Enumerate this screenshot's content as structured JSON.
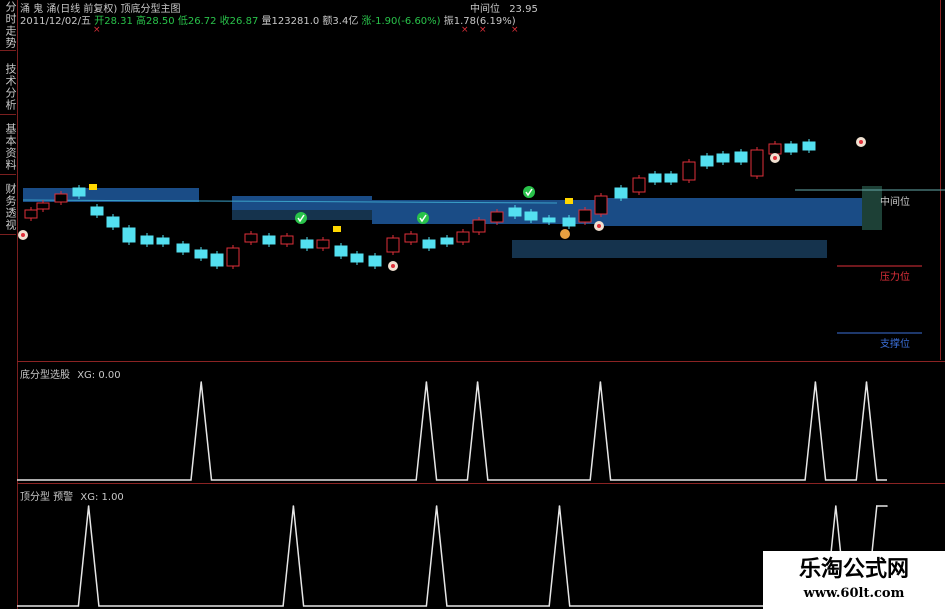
{
  "sidebar": {
    "tabs": [
      {
        "label": "分时走势"
      },
      {
        "label": "技术分析"
      },
      {
        "label": "基本资料"
      },
      {
        "label": "财务透视"
      }
    ]
  },
  "header": {
    "title_line": "涌 鬼 涌(日线 前复权) 顶底分型主图",
    "mid_label": "中间位",
    "mid_value": "23.95",
    "date": "2011/12/02/五",
    "open": "开28.31",
    "high": "高28.50",
    "low": "低26.72",
    "close": "收26.87",
    "volume": "量123281.0",
    "amount": "额3.4亿",
    "change": "涨-1.90(-6.60%)",
    "amplitude": "振1.78(6.19%)"
  },
  "levels": {
    "mid": "中间位",
    "pressure": "压力位",
    "support": "支撑位"
  },
  "panel1": {
    "label": "底分型选股",
    "value": "XG: 0.00"
  },
  "panel2": {
    "label": "顶分型 预警",
    "value": "XG: 1.00"
  },
  "watermark": {
    "title": "乐淘公式网",
    "url": "www.60lt.com"
  },
  "colors": {
    "up": "#e0303a",
    "down": "#54e0f0",
    "zone": "#1a4c86",
    "zone_dark": "#15334d",
    "grid_red": "#8b2323",
    "green": "#29c24a",
    "yellow": "#ffd700"
  },
  "icons": {
    "bottom_marker": "green-check-circle-icon",
    "top_marker": "red-dot-circle-icon"
  },
  "chart_data": [
    {
      "type": "line",
      "title": "底分型选股",
      "series": [
        {
          "name": "XG",
          "values": [
            0,
            0,
            0,
            0,
            0,
            0,
            0,
            0,
            0,
            0,
            0,
            0,
            0,
            0,
            0,
            0,
            0,
            0,
            1,
            0,
            0,
            0,
            0,
            0,
            0,
            0,
            0,
            0,
            0,
            0,
            0,
            0,
            0,
            0,
            0,
            0,
            0,
            0,
            0,
            0,
            1,
            0,
            0,
            0,
            0,
            1,
            0,
            0,
            0,
            0,
            0,
            0,
            0,
            0,
            0,
            0,
            0,
            1,
            0,
            0,
            0,
            0,
            0,
            0,
            0,
            0,
            0,
            0,
            0,
            0,
            0,
            0,
            0,
            0,
            0,
            0,
            0,
            0,
            1,
            0,
            0,
            0,
            0,
            1,
            0,
            0
          ]
        }
      ],
      "ylim": [
        0,
        1
      ]
    },
    {
      "type": "line",
      "title": "顶分型 预警",
      "series": [
        {
          "name": "XG",
          "values": [
            0,
            0,
            0,
            0,
            0,
            0,
            0,
            1,
            0,
            0,
            0,
            0,
            0,
            0,
            0,
            0,
            0,
            0,
            0,
            0,
            0,
            0,
            0,
            0,
            0,
            0,
            0,
            1,
            0,
            0,
            0,
            0,
            0,
            0,
            0,
            0,
            0,
            0,
            0,
            0,
            0,
            1,
            0,
            0,
            0,
            0,
            0,
            0,
            0,
            0,
            0,
            0,
            0,
            1,
            0,
            0,
            0,
            0,
            0,
            0,
            0,
            0,
            0,
            0,
            0,
            0,
            0,
            0,
            0,
            0,
            0,
            0,
            0,
            0,
            0,
            0,
            0,
            0,
            0,
            0,
            1,
            0,
            0,
            0,
            1,
            1
          ]
        }
      ],
      "ylim": [
        0,
        1
      ]
    }
  ]
}
